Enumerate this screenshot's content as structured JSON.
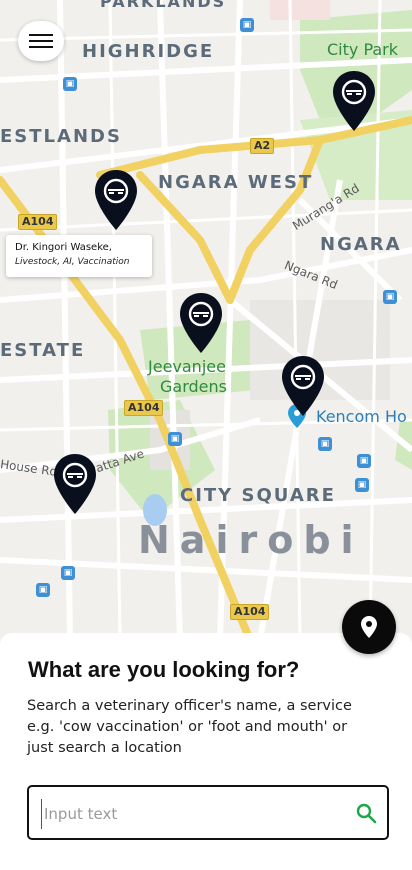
{
  "map": {
    "districts": {
      "parklands": "PARKLANDS",
      "highridge": "HIGHRIDGE",
      "westlands": "ESTLANDS",
      "ngara_west": "NGARA WEST",
      "ngara": "NGARA",
      "estate": "ESTATE",
      "city_square": "CITY SQUARE",
      "city": "Nairobi"
    },
    "places": {
      "city_park": "City Park",
      "jeevanjee_1": "Jeevanjee",
      "jeevanjee_2": "Gardens",
      "kencom": "Kencom Ho"
    },
    "streets": {
      "murangaa": "Murang'a Rd",
      "ngara_rd": "Ngara Rd",
      "house_rd": "House Rd",
      "kenyatta": "yatta Ave"
    },
    "road_badges": {
      "a2": "A2",
      "a104_1": "A104",
      "a104_2": "A104",
      "a104_3": "A104"
    },
    "colors": {
      "road_major": "#f2d163",
      "park_green": "#c8e6b0",
      "pin": "#0a0f1e"
    }
  },
  "info_card": {
    "name": "Dr. Kingori Waseke,",
    "services": "Livestock, AI, Vaccination"
  },
  "sheet": {
    "title": "What are you looking for?",
    "description": "Search a veterinary officer's name, a service e.g. 'cow vaccination' or 'foot and mouth' or just search a location",
    "search_placeholder": "Input text",
    "search_value": ""
  },
  "icons": {
    "menu": "hamburger-menu-icon",
    "locate": "location-pin-icon",
    "search": "magnifier-icon",
    "vet_pin": "vet-marker-icon"
  }
}
